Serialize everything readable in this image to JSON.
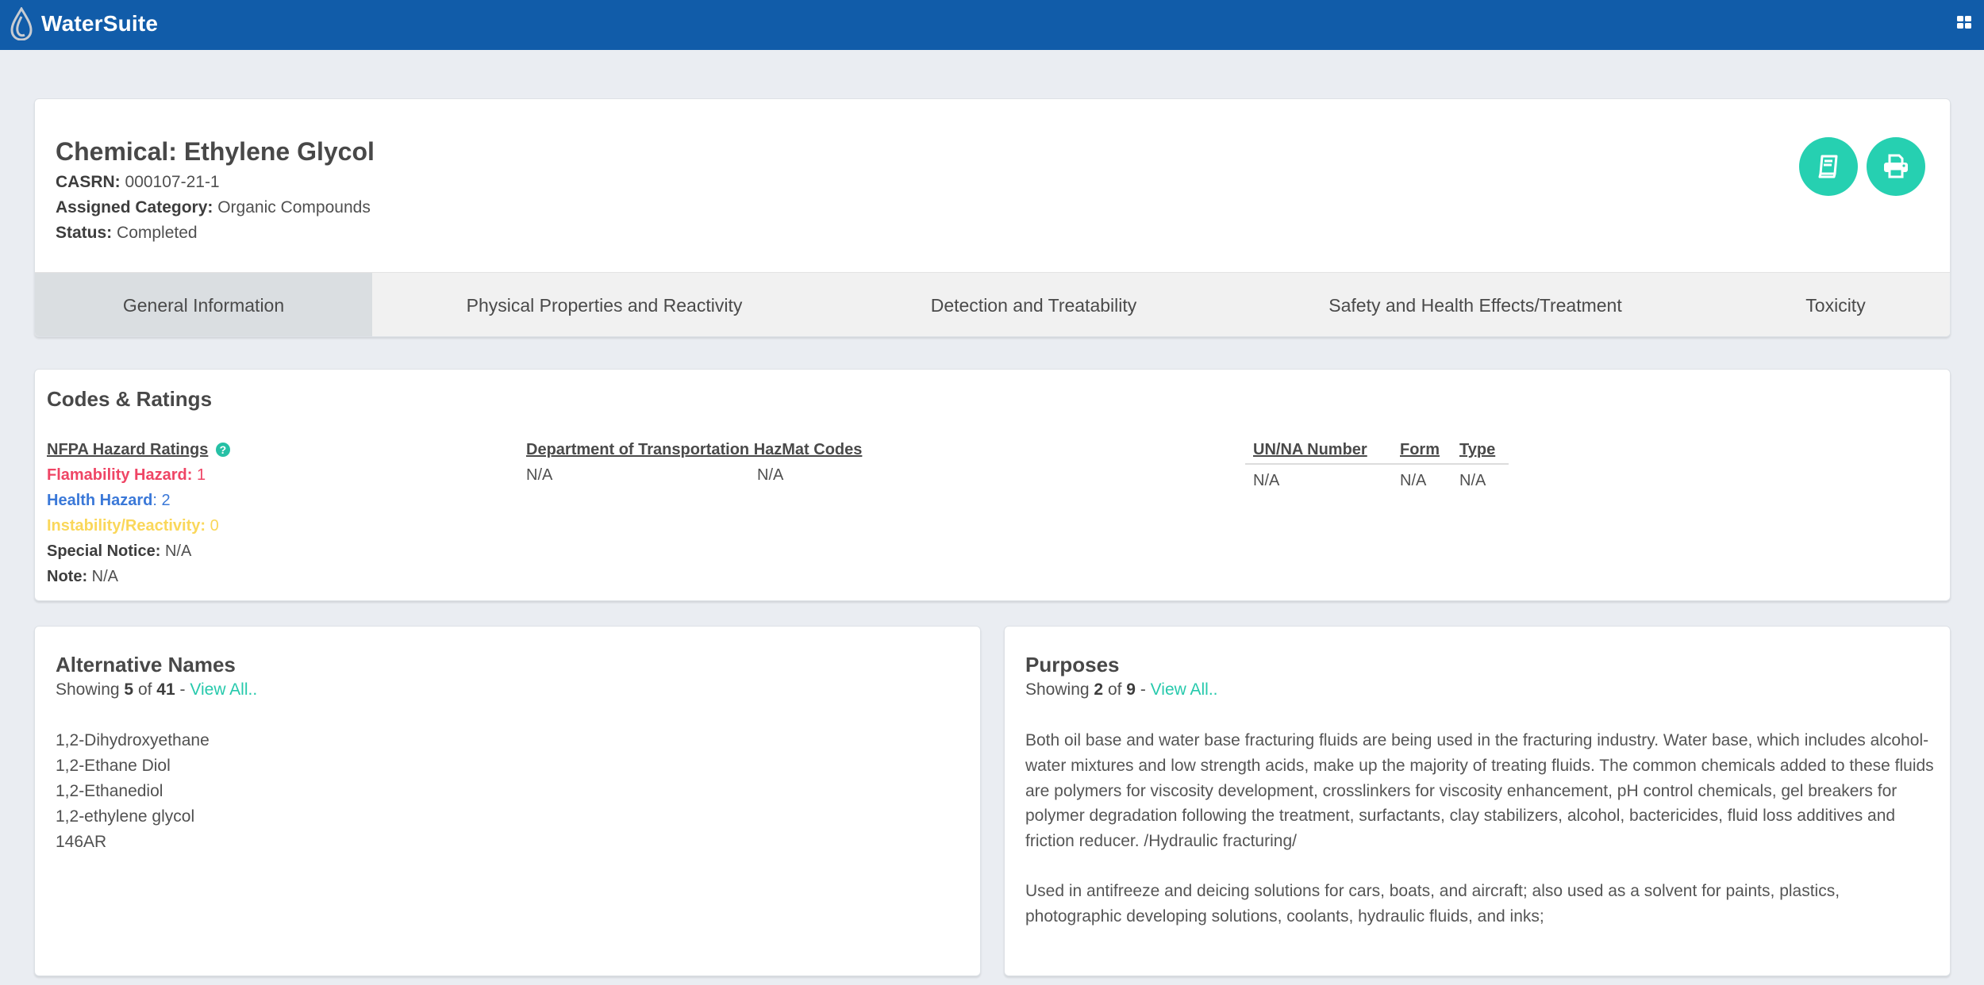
{
  "app": {
    "brand": "WaterSuite",
    "logo_icon": "water-drop-icon",
    "apps_icon": "grid-apps-icon",
    "brand_color": "#115ca9",
    "accent_color": "#26d0b1"
  },
  "header": {
    "title": "Chemical: Ethylene Glycol",
    "fields": [
      {
        "label": "CASRN:",
        "value": "000107-21-1"
      },
      {
        "label": "Assigned Category:",
        "value": "Organic Compounds"
      },
      {
        "label": "Status:",
        "value": "Completed"
      }
    ],
    "actions": [
      {
        "name": "references",
        "icon": "book-icon"
      },
      {
        "name": "print",
        "icon": "printer-icon"
      }
    ]
  },
  "tabs": [
    {
      "label": "General Information",
      "active": true
    },
    {
      "label": "Physical Properties and Reactivity",
      "active": false
    },
    {
      "label": "Detection and Treatability",
      "active": false
    },
    {
      "label": "Safety and Health Effects/Treatment",
      "active": false
    },
    {
      "label": "Toxicity",
      "active": false
    }
  ],
  "codes": {
    "title": "Codes & Ratings",
    "nfpa": {
      "heading": "NFPA Hazard Ratings",
      "help_icon": "?",
      "flammability": {
        "label": "Flamability Hazard:",
        "value": "1",
        "color": "#ef4565"
      },
      "health": {
        "label": "Health Hazard",
        "sep": ":",
        "value": "2",
        "color": "#3a78d8"
      },
      "instability": {
        "label": "Instability/Reactivity:",
        "value": "0",
        "color": "#fad75a"
      },
      "special_notice": {
        "label": "Special Notice:",
        "value": "N/A"
      },
      "note": {
        "label": "Note:",
        "value": "N/A"
      }
    },
    "dot": {
      "heading": "Department of Transportation HazMat Codes",
      "values": [
        "N/A",
        "N/A"
      ]
    },
    "un_table": {
      "columns": [
        "UN/NA Number",
        "Form",
        "Type"
      ],
      "rows": [
        [
          "N/A",
          "N/A",
          "N/A"
        ]
      ]
    }
  },
  "alternative_names": {
    "title": "Alternative Names",
    "showing_prefix": "Showing",
    "shown": "5",
    "of": "of",
    "total": "41",
    "dash": "-",
    "view_all": "View All..",
    "items": [
      "1,2-Dihydroxyethane",
      "1,2-Ethane Diol",
      "1,2-Ethanediol",
      "1,2-ethylene glycol",
      "146AR"
    ]
  },
  "purposes": {
    "title": "Purposes",
    "showing_prefix": "Showing",
    "shown": "2",
    "of": "of",
    "total": "9",
    "dash": "-",
    "view_all": "View All..",
    "items": [
      "Both oil base and water base fracturing fluids are being used in the fracturing industry. Water base, which includes alcohol-water mixtures and low strength acids, make up the majority of treating fluids. The common chemicals added to these fluids are polymers for viscosity development, crosslinkers for viscosity enhancement, pH control chemicals, gel breakers for polymer degradation following the treatment, surfactants, clay stabilizers, alcohol, bactericides, fluid loss additives and friction reducer. /Hydraulic fracturing/",
      "Used in antifreeze and deicing solutions for cars, boats, and aircraft; also used as a solvent for paints, plastics, photographic developing solutions, coolants, hydraulic fluids, and inks;"
    ]
  }
}
